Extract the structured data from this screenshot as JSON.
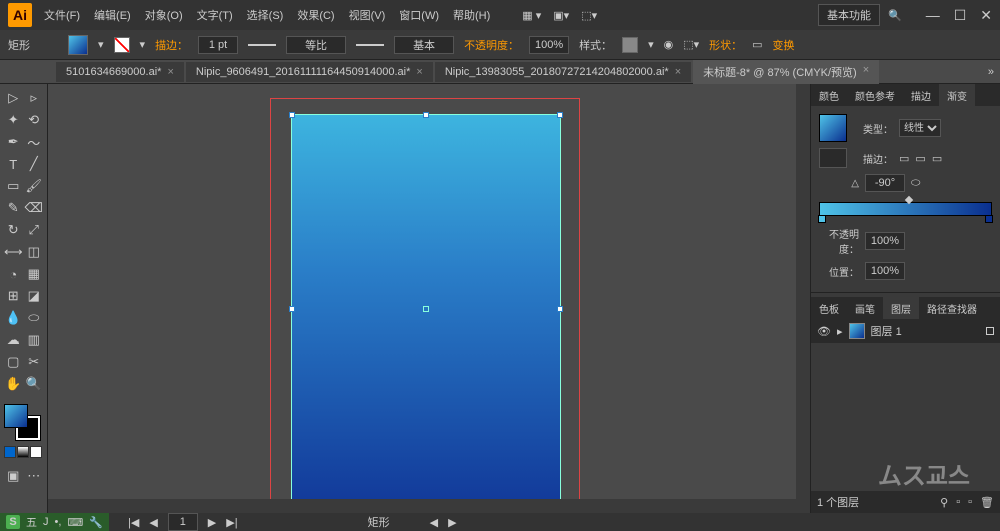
{
  "app": {
    "logo": "Ai"
  },
  "menu": [
    "文件(F)",
    "编辑(E)",
    "对象(O)",
    "文字(T)",
    "选择(S)",
    "效果(C)",
    "视图(V)",
    "窗口(W)",
    "帮助(H)"
  ],
  "workspace": "基本功能",
  "controlbar": {
    "tool": "矩形",
    "stroke_label": "描边：",
    "stroke_weight": "1 pt",
    "profile": "等比",
    "style_label": "样式：",
    "brush": "基本",
    "opacity_label": "不透明度：",
    "opacity": "100%",
    "shape_label": "形状：",
    "transform": "变换"
  },
  "tabs": [
    {
      "label": "5101634669000.ai*"
    },
    {
      "label": "Nipic_9606491_20161111164450914000.ai*"
    },
    {
      "label": "Nipic_13983055_20180727214204802000.ai*"
    },
    {
      "label": "未标题-8* @ 87% (CMYK/预览)",
      "active": true
    }
  ],
  "gradient_panel": {
    "tabs": [
      "颜色",
      "颜色参考",
      "描边",
      "渐变"
    ],
    "type_label": "类型：",
    "type": "线性",
    "stroke_label": "描边：",
    "angle": "-90°",
    "opacity_label": "不透明度：",
    "opacity": "100%",
    "position_label": "位置：",
    "position": "100%"
  },
  "layers_panel": {
    "tabs": [
      "色板",
      "画笔",
      "图层",
      "路径查找器"
    ],
    "layer_name": "图层 1",
    "count": "1 个图层"
  },
  "status": {
    "shape": "矩形",
    "ime_items": [
      "五",
      "J",
      "",
      "",
      ""
    ]
  },
  "chart_data": {
    "type": "gradient_rect",
    "direction": "vertical",
    "stops": [
      {
        "pos": 0,
        "color": "#3db4df"
      },
      {
        "pos": 100,
        "color": "#123a9a"
      }
    ],
    "angle": -90
  }
}
